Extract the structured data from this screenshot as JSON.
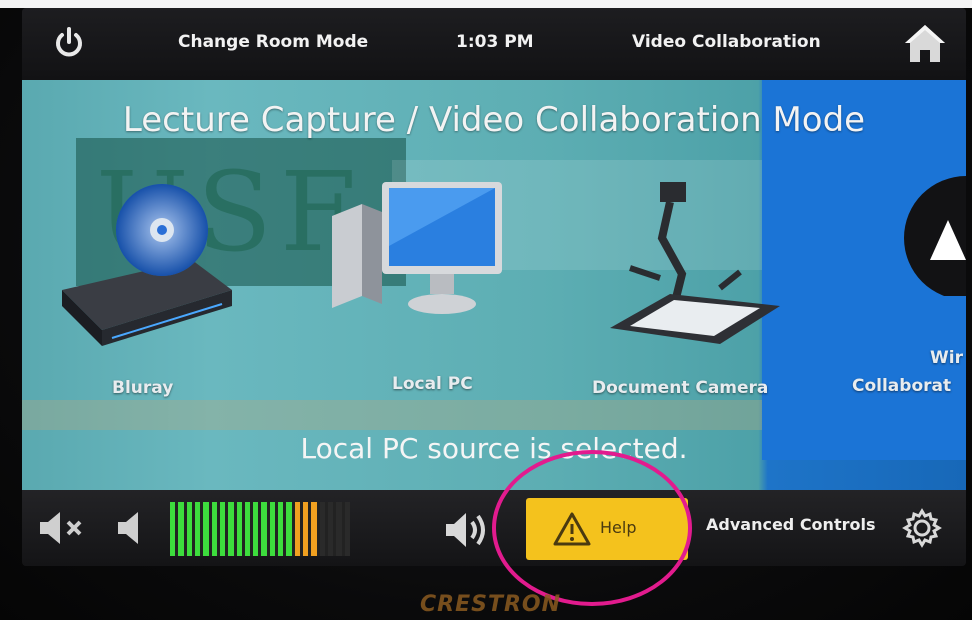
{
  "top_bar": {
    "change_mode_label": "Change Room Mode",
    "time": "1:03 PM",
    "current_mode": "Video Collaboration"
  },
  "main": {
    "title": "Lecture Capture / Video Collaboration Mode",
    "sources": [
      {
        "label": "Bluray",
        "icon": "bluray-player-icon"
      },
      {
        "label": "Local PC",
        "icon": "desktop-computer-icon"
      },
      {
        "label": "Document Camera",
        "icon": "document-camera-icon"
      },
      {
        "label": "Wir",
        "icon": "wireless-icon",
        "label_line2": "Collaborat"
      }
    ],
    "status": "Local PC source is selected."
  },
  "bottom_bar": {
    "help_label": "Help",
    "advanced_label": "Advanced Controls",
    "volume_level": 0.82
  },
  "footer": {
    "brand": "CRESTRON"
  },
  "colors": {
    "accent_help": "#f4c21d",
    "meter_green": "#3ddc3d",
    "meter_amber": "#f0a020",
    "highlight_ring": "#e21b8e"
  }
}
